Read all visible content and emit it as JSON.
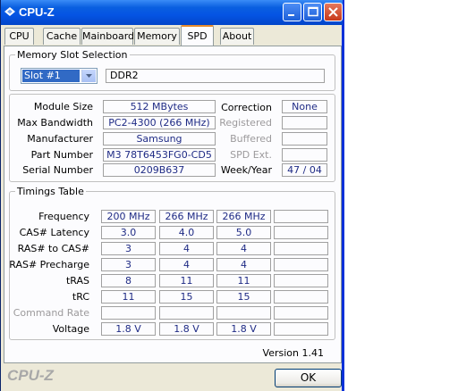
{
  "window": {
    "title": "CPU-Z",
    "icon": "cpuz-diamond-icon"
  },
  "tabs": [
    "CPU",
    "Cache",
    "Mainboard",
    "Memory",
    "SPD",
    "About"
  ],
  "active_tab": "SPD",
  "memory_slot": {
    "group_title": "Memory Slot Selection",
    "selected": "Slot #1",
    "type": "DDR2"
  },
  "module": {
    "size_label": "Module Size",
    "size": "512 MBytes",
    "bandwidth_label": "Max Bandwidth",
    "bandwidth": "PC2-4300 (266 MHz)",
    "manufacturer_label": "Manufacturer",
    "manufacturer": "Samsung",
    "part_label": "Part Number",
    "part": "M3 78T6453FG0-CD5",
    "serial_label": "Serial Number",
    "serial": "0209B637",
    "correction_label": "Correction",
    "correction": "None",
    "registered_label": "Registered",
    "registered": "",
    "buffered_label": "Buffered",
    "buffered": "",
    "spd_ext_label": "SPD Ext.",
    "spd_ext": "",
    "week_year_label": "Week/Year",
    "week_year": "47 / 04"
  },
  "timings": {
    "group_title": "Timings Table",
    "rows": [
      {
        "label": "Frequency",
        "values": [
          "200 MHz",
          "266 MHz",
          "266 MHz",
          ""
        ],
        "dim": false
      },
      {
        "label": "CAS# Latency",
        "values": [
          "3.0",
          "4.0",
          "5.0",
          ""
        ],
        "dim": false
      },
      {
        "label": "RAS# to CAS#",
        "values": [
          "3",
          "4",
          "4",
          ""
        ],
        "dim": false
      },
      {
        "label": "RAS# Precharge",
        "values": [
          "3",
          "4",
          "4",
          ""
        ],
        "dim": false
      },
      {
        "label": "tRAS",
        "values": [
          "8",
          "11",
          "11",
          ""
        ],
        "dim": false
      },
      {
        "label": "tRC",
        "values": [
          "11",
          "15",
          "15",
          ""
        ],
        "dim": false
      },
      {
        "label": "Command Rate",
        "values": [
          "",
          "",
          "",
          ""
        ],
        "dim": true
      },
      {
        "label": "Voltage",
        "values": [
          "1.8 V",
          "1.8 V",
          "1.8 V",
          ""
        ],
        "dim": false
      }
    ]
  },
  "footer": {
    "version": "Version 1.41",
    "brand": "CPU-Z",
    "ok_label": "OK"
  }
}
